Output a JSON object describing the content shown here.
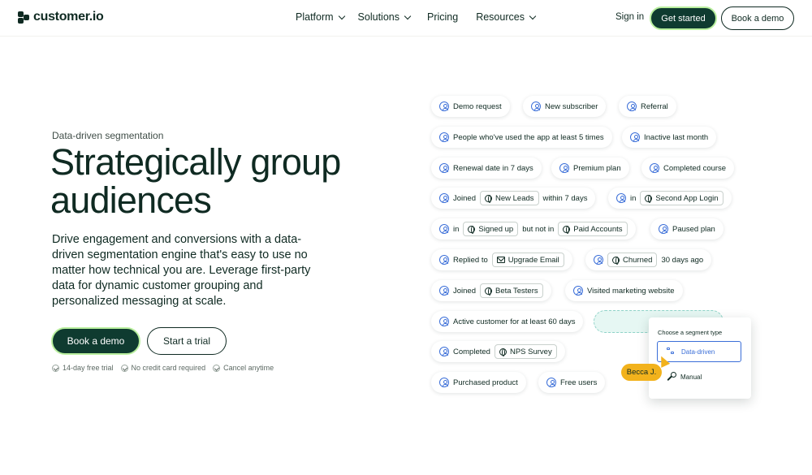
{
  "brand": {
    "name": "customer.io"
  },
  "nav": {
    "items": [
      {
        "label": "Platform",
        "dropdown": true
      },
      {
        "label": "Solutions",
        "dropdown": true
      },
      {
        "label": "Pricing",
        "dropdown": false
      },
      {
        "label": "Resources",
        "dropdown": true
      }
    ],
    "signin": "Sign in",
    "get_started": "Get started",
    "book_demo": "Book a demo"
  },
  "hero": {
    "eyebrow": "Data-driven segmentation",
    "headline": "Strategically group audiences",
    "lede": "Drive engagement and conversions with a data-driven segmentation engine that's easy to use no matter how technical you are. Leverage first-party data for dynamic customer grouping and personalized messaging at scale.",
    "cta_primary": "Book a demo",
    "cta_secondary": "Start a trial",
    "perks": [
      "14-day free trial",
      "No credit card required",
      "Cancel anytime"
    ]
  },
  "tags": {
    "demo_request": "Demo request",
    "new_subscriber": "New subscriber",
    "referral": "Referral",
    "used_app": "People who've used the app at least 5 times",
    "inactive": "Inactive last month",
    "renewal": "Renewal date in 7 days",
    "premium": "Premium plan",
    "completed_course": "Completed course",
    "joined": "Joined",
    "new_leads": "New Leads",
    "within_7": "within 7 days",
    "in": "in",
    "second_app_login": "Second App Login",
    "signed_up": "Signed up",
    "but_not_in": "but not in",
    "paid_accounts": "Paid Accounts",
    "paused_plan": "Paused plan",
    "replied_to": "Replied to",
    "upgrade_email": "Upgrade Email",
    "churned": "Churned",
    "days_30_ago": "30 days ago",
    "beta_testers": "Beta Testers",
    "visited_marketing": "Visited marketing website",
    "active_60": "Active customer for at least 60 days",
    "completed": "Completed",
    "nps_survey": "NPS Survey",
    "purchased": "Purchased product",
    "free_users": "Free users"
  },
  "segment_card": {
    "title": "Choose a segment type",
    "option_selected": "Data-driven",
    "option_other": "Manual"
  },
  "cursor_label": "Becca J.",
  "colors": {
    "primary_dark": "#0f3b30",
    "accent_green": "#b9ef9e",
    "icon_blue": "#3a6ed8",
    "cursor_yellow": "#f2b21c"
  }
}
